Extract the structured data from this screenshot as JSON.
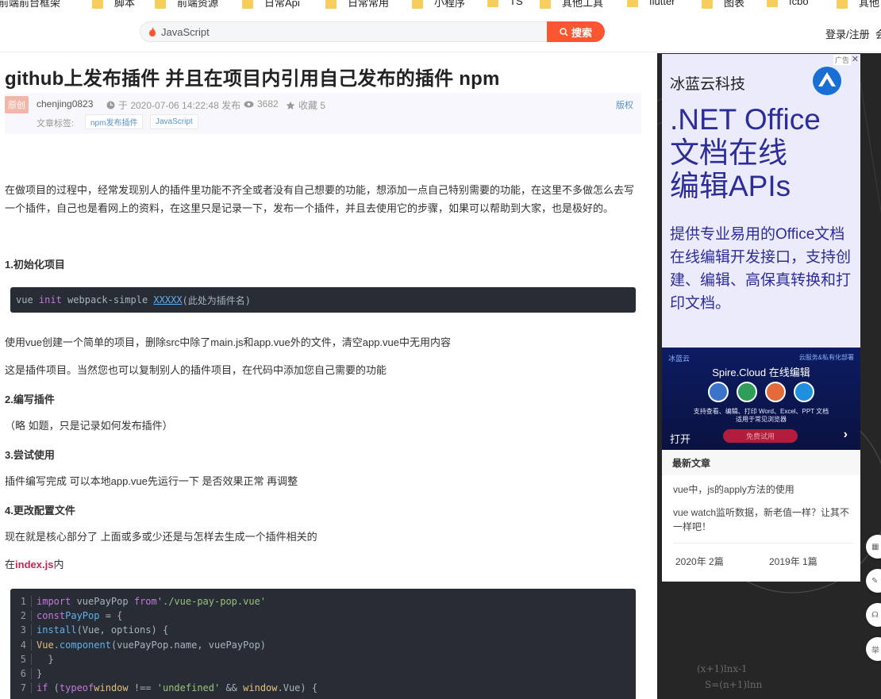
{
  "bookmarks": [
    "前端前台框架",
    "脚本",
    "前端资源",
    "日常Api",
    "日常常用",
    "小程序",
    "TS",
    "其他工具",
    "flutter",
    "图表",
    "fcbo",
    "其他"
  ],
  "search": {
    "value": "JavaScript",
    "button": "搜索"
  },
  "header": {
    "login": "登录/注册",
    "extra": "会"
  },
  "article": {
    "title": "github上发布插件 并且在项目内引用自己发布的插件 npm",
    "badge": "原创",
    "author": "chenjing0823",
    "date": "于 2020-07-06 14:22:48 发布",
    "views": "3682",
    "favorites": "收藏 5",
    "copyright": "版权",
    "tags_label": "文章标签:",
    "tags": [
      "npm发布插件",
      "JavaScript"
    ],
    "intro": "在做项目的过程中，经常发现别人的插件里功能不齐全或者没有自己想要的功能，想添加一点自己特别需要的功能，在这里不多做怎么去写一个插件，自己也是看网上的资料，在这里只是记录一下，发布一个插件，并且去使用它的步骤，如果可以帮助到大家，也是极好的。",
    "h1": "1.初始化项目",
    "code1": {
      "cmd": "vue",
      "kw": "init",
      "rest": " webpack-simple ",
      "hl": "XXXXX",
      "comment": "(此处为插件名)"
    },
    "p1": "使用vue创建一个简单的项目，删除src中除了main.js和app.vue外的文件，清空app.vue中无用内容",
    "p2": "这是插件项目。当然您也可以复制别人的插件项目，在代码中添加您自己需要的功能",
    "h2": "2.编写插件",
    "p3": "（略 如题，只是记录如何发布插件）",
    "h3": "3.尝试使用",
    "p4": "插件编写完成 可以本地app.vue先运行一下 是否效果正常 再调整",
    "h4": "4.更改配置文件",
    "p5": "现在就是核心部分了 上面或多或少还是与怎样去生成一个插件相关的",
    "p6_pre": "在",
    "p6_file": "index.js",
    "p6_post": "内",
    "code2_lines": [
      "1",
      "2",
      "3",
      "4",
      "5",
      "6",
      "7"
    ]
  },
  "ad": {
    "label": "广告",
    "brand": "冰蓝云科技",
    "heading1": ".NET Office",
    "heading2": "文档在线",
    "heading3": "编辑APIs",
    "desc": "提供专业易用的Office文档在线编辑开发接口，支持创建、编辑、高保真转换和打印文档。",
    "banner_brand": "冰蓝云",
    "banner_right": "云服务&私有化部署",
    "banner_title": "Spire.Cloud 在线编辑",
    "banner_sub1": "支持查看、编辑、打印 Word、Excel、PPT 文档",
    "banner_sub2": "适用于常见浏览器",
    "open": "打开",
    "trial": "免费试用"
  },
  "latest": {
    "heading": "最新文章",
    "items": [
      "vue中，js的apply方法的使用",
      "vue watch监听数据，新老值一样？让其不一样吧！"
    ],
    "archive": [
      "2020年  2篇",
      "2019年  1篇"
    ]
  },
  "colors": {
    "accent": "#fc5531",
    "dark": "#282c34",
    "ad_text": "#2d2d9a"
  }
}
